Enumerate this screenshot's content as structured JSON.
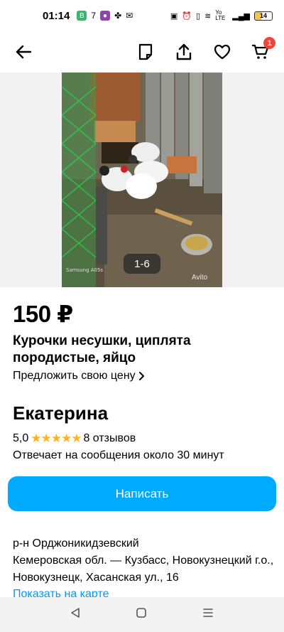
{
  "status_bar": {
    "time": "01:14",
    "notif_1": "7",
    "network": "Yo LTE",
    "battery": "14"
  },
  "header": {
    "cart_count": "1"
  },
  "gallery": {
    "counter": "1-6",
    "watermark": "Avito"
  },
  "listing": {
    "price": "150 ₽",
    "title": "Курочки несушки, циплята породистые, яйцо",
    "offer_price": "Предложить свою цену"
  },
  "seller": {
    "name": "Екатерина",
    "rating": "5,0",
    "stars": "★★★★★",
    "reviews": "8 отзывов",
    "response": "Отвечает на сообщения около 30 минут"
  },
  "actions": {
    "write": "Написать"
  },
  "location": {
    "district": "р-н Орджоникидзевский",
    "address": "Кемеровская обл. — Кузбасс, Новокузнецкий г.о., Новокузнецк, Хасанская ул., 16",
    "show_map": "Показать на карте"
  },
  "colors": {
    "accent": "#00aaff",
    "link": "#0099f7",
    "badge": "#f0443a",
    "star": "#ffb321"
  }
}
